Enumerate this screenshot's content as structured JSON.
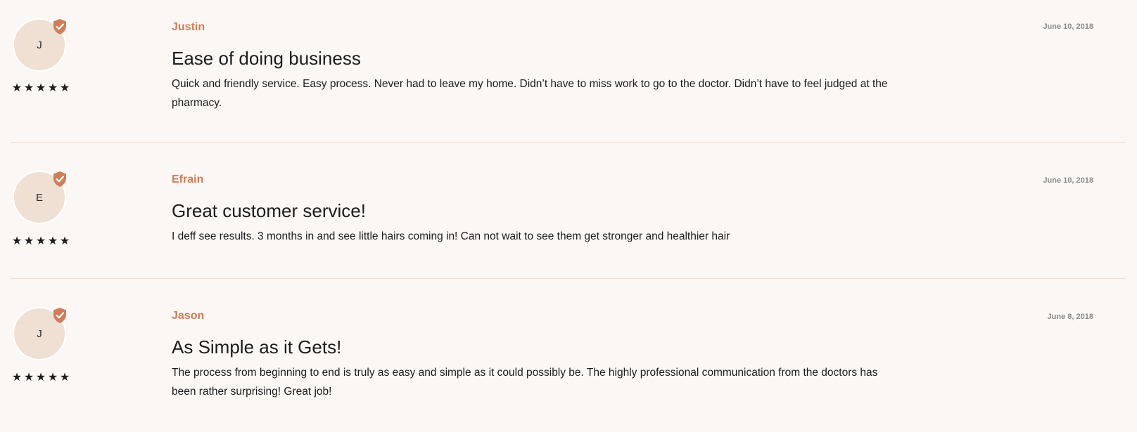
{
  "colors": {
    "background": "#faf7f5",
    "accent": "#cd7e5a",
    "avatar_bg": "#efe0d3",
    "divider": "#f0dccf"
  },
  "reviews": [
    {
      "initial": "J",
      "name": "Justin",
      "date": "June 10, 2018",
      "rating": 5,
      "verified_icon": "shield-check-icon",
      "title": "Ease of doing business",
      "body": "Quick and friendly service. Easy process. Never had to leave my home. Didn’t have to miss work to go to the doctor. Didn’t have to feel judged at the pharmacy."
    },
    {
      "initial": "E",
      "name": "Efrain",
      "date": "June 10, 2018",
      "rating": 5,
      "verified_icon": "shield-check-icon",
      "title": "Great customer service!",
      "body": "I deff see results. 3 months in and see little hairs coming in! Can not wait to see them get stronger and healthier hair"
    },
    {
      "initial": "J",
      "name": "Jason",
      "date": "June 8, 2018",
      "rating": 5,
      "verified_icon": "shield-check-icon",
      "title": "As Simple as it Gets!",
      "body": "The process from beginning to end is truly as easy and simple as it could possibly be. The highly professional communication from the doctors has been rather surprising! Great job!"
    }
  ]
}
